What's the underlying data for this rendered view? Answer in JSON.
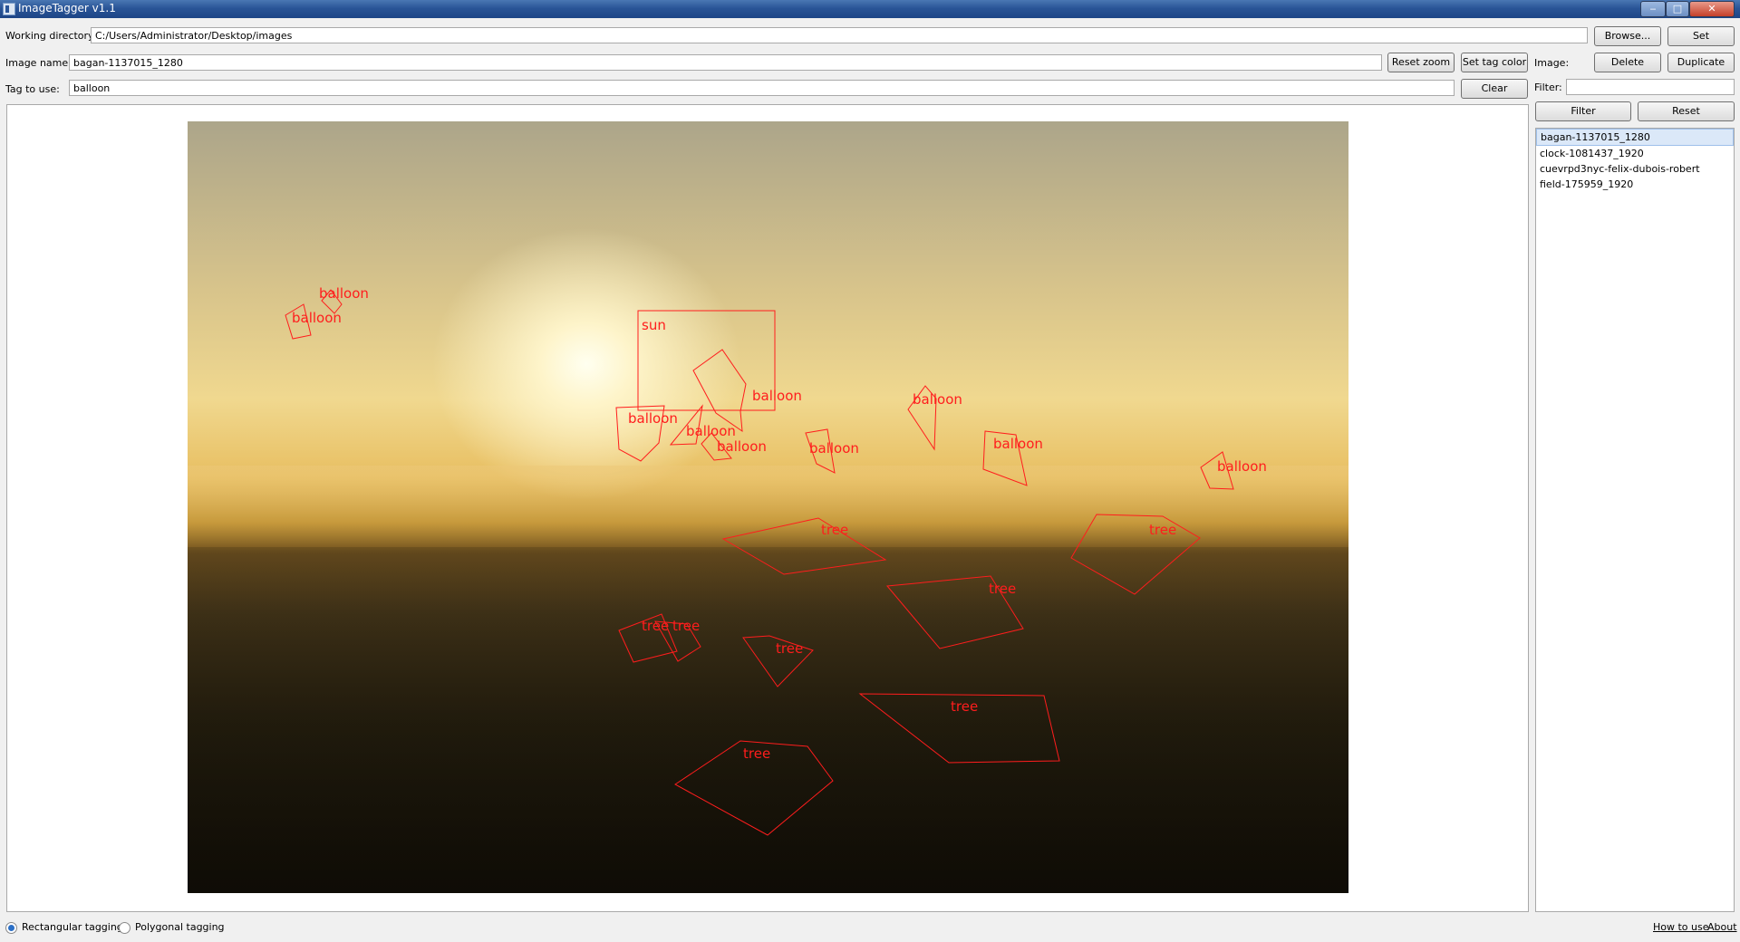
{
  "window": {
    "title": "ImageTagger v1.1",
    "minimize": "‒",
    "maximize": "□",
    "close": "✕"
  },
  "toolbar": {
    "working_directory_label": "Working directory:",
    "working_directory_value": "C:/Users/Administrator/Desktop/images",
    "image_name_label": "Image name:",
    "image_name_value": "bagan-1137015_1280",
    "tag_label": "Tag to use:",
    "tag_value": "balloon",
    "browse": "Browse...",
    "set": "Set",
    "reset_zoom": "Reset zoom",
    "set_tag_color": "Set tag color",
    "clear": "Clear"
  },
  "side": {
    "image_label": "Image:",
    "delete": "Delete",
    "duplicate": "Duplicate",
    "filter_label": "Filter:",
    "filter_value": "",
    "filter_button": "Filter",
    "reset_button": "Reset",
    "files": [
      "bagan-1137015_1280",
      "clock-1081437_1920",
      "cuevrpd3nyc-felix-dubois-robert",
      "field-175959_1920"
    ],
    "selected_index": 0
  },
  "bottom": {
    "rect_label": "Rectangular tagging",
    "poly_label": "Polygonal tagging",
    "mode": "Rectangular tagging",
    "how_to_use": "How to use",
    "about": "About"
  },
  "tag_color": "#ff1d1d",
  "annotations": [
    {
      "tag": "balloon"
    },
    {
      "tag": "balloon"
    },
    {
      "tag": "sun"
    },
    {
      "tag": "balloon"
    },
    {
      "tag": "balloon"
    },
    {
      "tag": "balloon"
    },
    {
      "tag": "balloon"
    },
    {
      "tag": "balloon"
    },
    {
      "tag": "balloon"
    },
    {
      "tag": "balloon"
    },
    {
      "tag": "balloon"
    },
    {
      "tag": "tree"
    },
    {
      "tag": "tree"
    },
    {
      "tag": "tree"
    },
    {
      "tag": "tree"
    },
    {
      "tag": "tree"
    },
    {
      "tag": "tree"
    },
    {
      "tag": "tree"
    },
    {
      "tag": "tree"
    }
  ]
}
